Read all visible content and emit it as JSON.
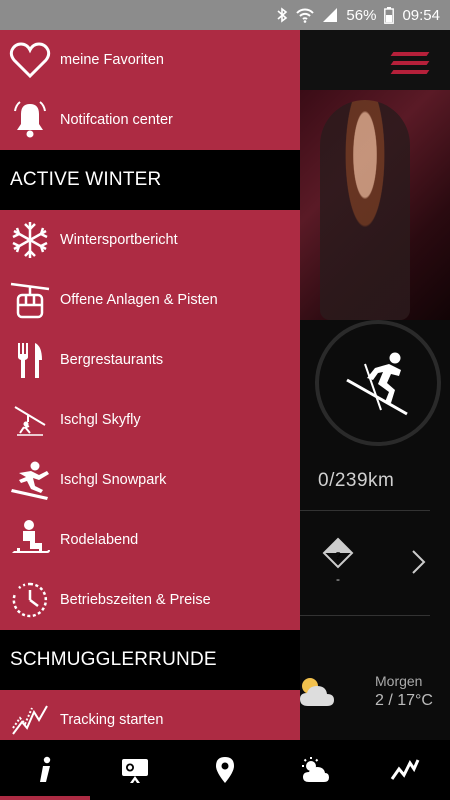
{
  "status_bar": {
    "battery": "56%",
    "time": "09:54"
  },
  "background": {
    "km_text": "0/239km",
    "warning_value": "-",
    "forecast": {
      "label": "Morgen",
      "temp": "2 / 17°C"
    }
  },
  "drawer": {
    "items_top": [
      {
        "label": "meine Favoriten",
        "icon": "heart-icon"
      },
      {
        "label": "Notifcation center",
        "icon": "bell-icon"
      }
    ],
    "section_active_winter": "ACTIVE WINTER",
    "items_winter": [
      {
        "label": "Wintersportbericht",
        "icon": "snowflake-icon"
      },
      {
        "label": "Offene Anlagen & Pisten",
        "icon": "gondola-icon"
      },
      {
        "label": "Bergrestaurants",
        "icon": "fork-knife-icon"
      },
      {
        "label": "Ischgl Skyfly",
        "icon": "zipline-icon"
      },
      {
        "label": "Ischgl Snowpark",
        "icon": "snowboarder-icon"
      },
      {
        "label": "Rodelabend",
        "icon": "sled-icon"
      },
      {
        "label": "Betriebszeiten & Preise",
        "icon": "clock-icon"
      }
    ],
    "section_schmugglerrunde": "SCHMUGGLERRUNDE",
    "items_schmuggler": [
      {
        "label": "Tracking starten",
        "icon": "tracking-icon"
      }
    ]
  },
  "bottom_nav": {
    "tabs": [
      {
        "icon": "info-icon",
        "active": true
      },
      {
        "icon": "webcam-icon",
        "active": false
      },
      {
        "icon": "location-pin-icon",
        "active": false
      },
      {
        "icon": "weather-icon",
        "active": false
      },
      {
        "icon": "activity-icon",
        "active": false
      }
    ]
  },
  "colors": {
    "accent": "#ad2b43",
    "status_bar": "#8c8c8c",
    "background": "#000000"
  }
}
